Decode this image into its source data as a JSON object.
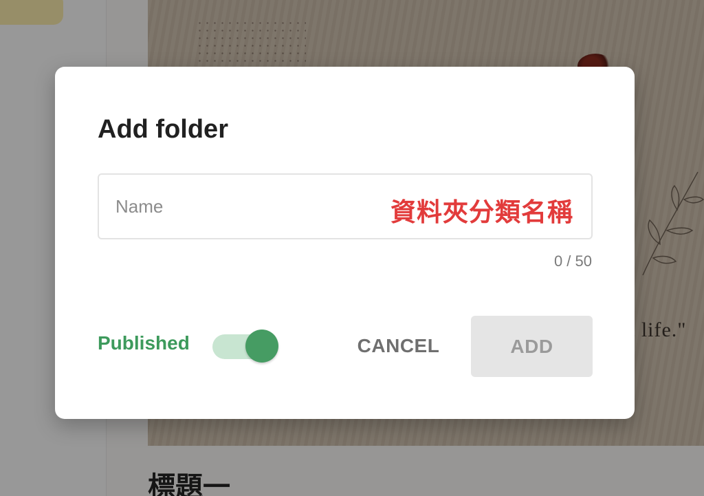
{
  "background": {
    "quote_fragment": "t life.\"",
    "heading_fragment": "標題一"
  },
  "dialog": {
    "title": "Add folder",
    "name_field": {
      "placeholder": "Name",
      "value": "",
      "counter": "0 / 50"
    },
    "annotation": "資料夾分類名稱",
    "published": {
      "label": "Published",
      "enabled": true
    },
    "cancel_label": "CANCEL",
    "add_label": "ADD"
  },
  "colors": {
    "accent_green": "#3d9a5c",
    "annotation_red": "#e23b3b",
    "disabled_button": "#e5e5e5"
  }
}
